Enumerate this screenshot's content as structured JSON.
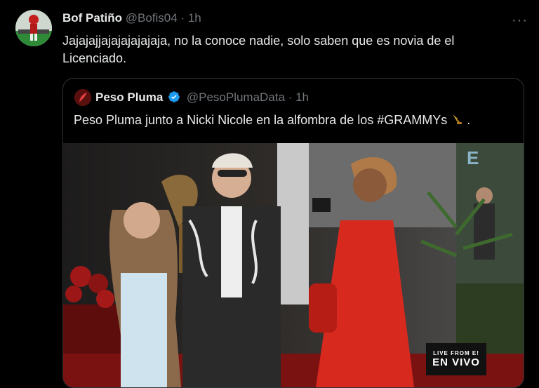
{
  "tweet": {
    "author_name": "Bof Patiño",
    "handle": "@Bofis04",
    "separator": "·",
    "time": "1h",
    "more_icon": "more-icon",
    "text": "Jajajajjajajajajajaja, no la conoce nadie, solo saben que es novia de el Licenciado."
  },
  "quoted_tweet": {
    "author_name": "Peso Pluma",
    "handle": "@PesoPlumaData",
    "separator": "·",
    "time": "1h",
    "verified_icon": "verified-badge-icon",
    "text": "Peso Pluma junto a Nicki Nicole en la alfombra de los #GRAMMYs",
    "emoji_icon": "gramophone-icon",
    "text_end": "."
  },
  "media": {
    "live_badge_small": "LIVE FROM E!",
    "live_badge_big": "EN VIVO"
  },
  "colors": {
    "background": "#000000",
    "text": "#e7e9ea",
    "muted": "#71767b",
    "border": "#2f3336",
    "verified": "#1d9bf0"
  }
}
